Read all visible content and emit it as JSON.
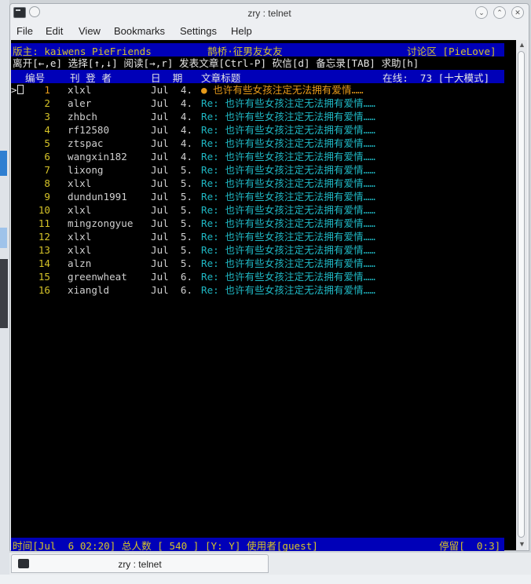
{
  "window": {
    "title": "zry : telnet"
  },
  "menu": [
    "File",
    "Edit",
    "View",
    "Bookmarks",
    "Settings",
    "Help"
  ],
  "terminal": {
    "header": {
      "moderator_label": "版主: kaiwens PieFriends",
      "board_title": "鹊桥·征男友女友",
      "board_area": "讨论区 [PieLove]"
    },
    "keys_help": "离开[←,e] 选择[↑,↓] 阅读[→,r] 发表文章[Ctrl-P] 砍信[d] 备忘录[TAB] 求助[h]",
    "columns": {
      "num": "编号",
      "author": "刊 登 者",
      "date": "日  期",
      "title": "文章标题",
      "online": "在线:  73 [十大模式]"
    },
    "cursor_marker": ">",
    "posts": [
      {
        "num": "1",
        "author": "xlxl",
        "date": "Jul  4.",
        "title": "● 也许有些女孩注定无法拥有爱情……"
      },
      {
        "num": "2",
        "author": "aler",
        "date": "Jul  4.",
        "title": "Re: 也许有些女孩注定无法拥有爱情……"
      },
      {
        "num": "3",
        "author": "zhbch",
        "date": "Jul  4.",
        "title": "Re: 也许有些女孩注定无法拥有爱情……"
      },
      {
        "num": "4",
        "author": "rf12580",
        "date": "Jul  4.",
        "title": "Re: 也许有些女孩注定无法拥有爱情……"
      },
      {
        "num": "5",
        "author": "ztspac",
        "date": "Jul  4.",
        "title": "Re: 也许有些女孩注定无法拥有爱情……"
      },
      {
        "num": "6",
        "author": "wangxin182",
        "date": "Jul  4.",
        "title": "Re: 也许有些女孩注定无法拥有爱情……"
      },
      {
        "num": "7",
        "author": "lixong",
        "date": "Jul  5.",
        "title": "Re: 也许有些女孩注定无法拥有爱情……"
      },
      {
        "num": "8",
        "author": "xlxl",
        "date": "Jul  5.",
        "title": "Re: 也许有些女孩注定无法拥有爱情……"
      },
      {
        "num": "9",
        "author": "dundun1991",
        "date": "Jul  5.",
        "title": "Re: 也许有些女孩注定无法拥有爱情……"
      },
      {
        "num": "10",
        "author": "xlxl",
        "date": "Jul  5.",
        "title": "Re: 也许有些女孩注定无法拥有爱情……"
      },
      {
        "num": "11",
        "author": "mingzongyue",
        "date": "Jul  5.",
        "title": "Re: 也许有些女孩注定无法拥有爱情……"
      },
      {
        "num": "12",
        "author": "xlxl",
        "date": "Jul  5.",
        "title": "Re: 也许有些女孩注定无法拥有爱情……"
      },
      {
        "num": "13",
        "author": "xlxl",
        "date": "Jul  5.",
        "title": "Re: 也许有些女孩注定无法拥有爱情……"
      },
      {
        "num": "14",
        "author": "alzn",
        "date": "Jul  5.",
        "title": "Re: 也许有些女孩注定无法拥有爱情……"
      },
      {
        "num": "15",
        "author": "greenwheat",
        "date": "Jul  6.",
        "title": "Re: 也许有些女孩注定无法拥有爱情……"
      },
      {
        "num": "16",
        "author": "xiangld",
        "date": "Jul  6.",
        "title": "Re: 也许有些女孩注定无法拥有爱情……"
      }
    ],
    "status": {
      "left": "时间[Jul  6 02:20] 总人数 [ 540 ] [Y: Y] 使用者[guest]",
      "right": "停留[  0:3]"
    }
  },
  "tab": {
    "label": "zry : telnet"
  },
  "colors": {
    "header_bg": "#0000b8",
    "header_fg": "#d6c428",
    "first_title": "#e69a1a",
    "reply_title": "#1fb8c4",
    "terminal_bg": "#000000"
  }
}
